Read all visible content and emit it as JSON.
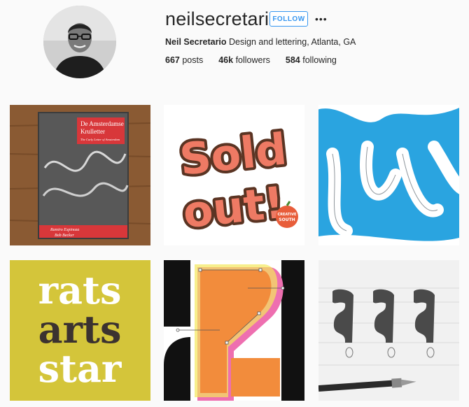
{
  "profile": {
    "username": "neilsecretario",
    "follow_label": "FOLLOW",
    "more_label": "•••",
    "full_name": "Neil Secretario",
    "bio": "Design and lettering, Atlanta, GA",
    "stats": {
      "posts_count": "667",
      "posts_label": "posts",
      "followers_count": "46k",
      "followers_label": "followers",
      "following_count": "584",
      "following_label": "following"
    }
  },
  "posts": {
    "book": {
      "title_line1": "De Amsterdamse",
      "title_line2": "Krulletter",
      "subtitle": "The Curly Letter of Amsterdam",
      "author1": "Ramiro Espinoza",
      "author2": "Bob Becker"
    },
    "sold_out": {
      "line1": "Sold",
      "line2": "out!",
      "badge_line1": "CREATIVE",
      "badge_line2": "SOUTH"
    },
    "rats": {
      "line1": "rats",
      "line2": "arts",
      "line3": "star"
    }
  },
  "colors": {
    "follow_blue": "#3897f0",
    "sold_out_salmon": "#ee7a64",
    "script_blue": "#2aa4e0",
    "rats_yellow": "#d4c53a"
  }
}
